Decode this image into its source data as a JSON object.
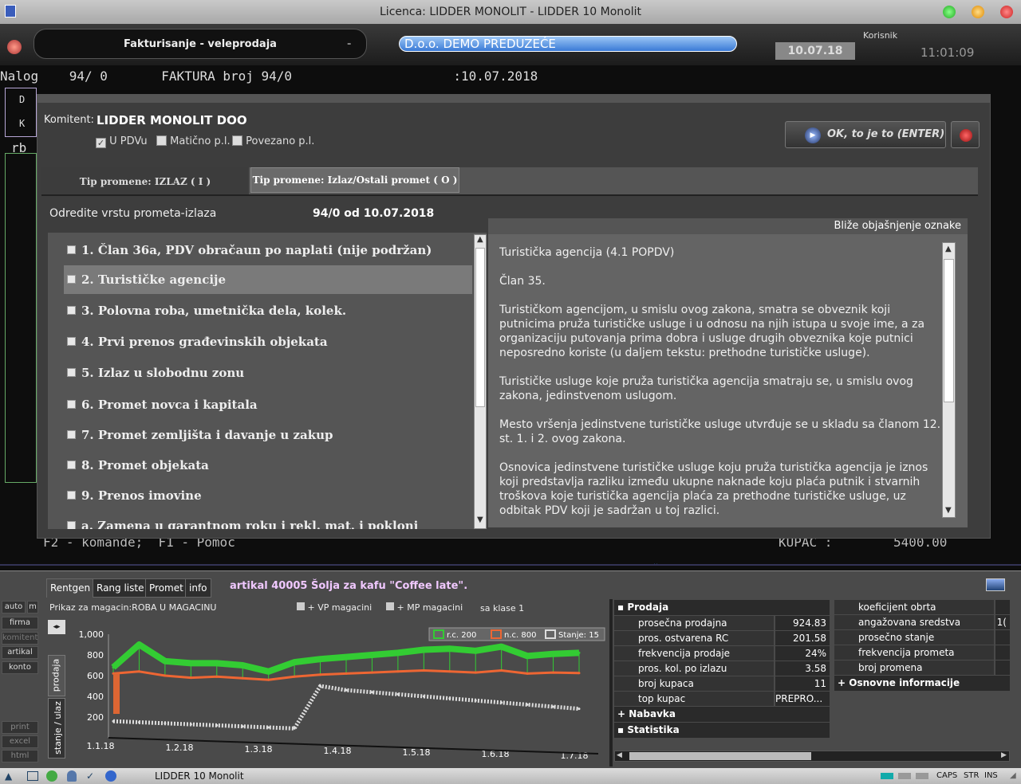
{
  "window": {
    "title": "Licenca: LIDDER MONOLIT - LIDDER 10 Monolit"
  },
  "header": {
    "module": "Fakturisanje - veleprodaja",
    "company": "D.o.o. DEMO PREDUZEĆE",
    "user_label": "Korisnik",
    "date": "10.07.18",
    "time": "11:01:09"
  },
  "terminal": {
    "line1": "Nalog    94/ 0       FAKTURA broj 94/0                     :10.07.2018",
    "rb": "rb",
    "footer": "F2 - komande;  F1 - Pomoc",
    "kupac_label": "KUPAC :",
    "kupac_value": "5400.00",
    "d_letter": "D",
    "k_letter": "K"
  },
  "dialog": {
    "komitent_label": "Komitent:",
    "komitent_value": "LIDDER MONOLIT DOO",
    "checks": [
      {
        "label": "U PDVu",
        "checked": true
      },
      {
        "label": "Matično p.l.",
        "checked": false
      },
      {
        "label": "Povezano p.l.",
        "checked": false
      }
    ],
    "ok_label": "OK, to je to (ENTER)",
    "tabs": [
      {
        "label": "Tip promene: IZLAZ ( I )"
      },
      {
        "label": "Tip promene: Izlaz/Ostali promet ( O )"
      }
    ],
    "prompt": "Odredite vrstu prometa-izlaza",
    "doc_ref": "94/0 od 10.07.2018",
    "items": [
      "1. Član 36a, PDV obračaun po naplati (nije podržan)",
      "2. Turističke agencije",
      "3. Polovna roba, umetnička dela, kolek.",
      "4. Prvi prenos građevinskih objekata",
      "5. Izlaz u slobodnu zonu",
      "6. Promet novca i kapitala",
      "7. Promet zemljišta i davanje u zakup",
      "8. Promet objekata",
      "9. Prenos imovine",
      "a. Zamena u garantnom roku i rekl. mat. i pokloni"
    ],
    "desc_header": "Bliže objašnjenje oznake",
    "desc": [
      "Turistička agencija (4.1 POPDV)",
      "Član 35.",
      "Turističkom agencijom, u smislu ovog zakona, smatra se obveznik koji putnicima pruža turističke usluge i u odnosu na njih istupa u svoje ime, a za organizaciju putovanja prima dobra i usluge drugih obveznika koje putnici neposredno koriste (u daljem tekstu: prethodne turističke usluge).",
      "Turističke usluge koje pruža turistička agencija smatraju se, u smislu ovog zakona, jedinstvenom uslugom.",
      "Mesto vršenja jedinstvene turističke usluge utvrđuje se u skladu sa članom 12. st. 1. i 2. ovog zakona.",
      "Osnovica jedinstvene turističke usluge koju pruža turistička agencija je iznos koji predstavlja razliku između ukupne naknade koju plaća putnik i stvarnih troškova koje turistička agencija plaća za prethodne turističke usluge, uz odbitak PDV koji je sadržan u toj razlici."
    ]
  },
  "bottom": {
    "tabs": [
      "Rentgen",
      "Rang liste",
      "Promet",
      "info"
    ],
    "article": "artikal 40005 Šolja za kafu \"Coffee late\".",
    "side": [
      "auto",
      "m",
      "firma",
      "komitent",
      "artikal",
      "konto",
      "print",
      "excel",
      "html"
    ],
    "prikaz": "Prikaz za magacin:ROBA U MAGACINU",
    "vp": "+ VP magacini",
    "mp": "+ MP magacini",
    "klasa": "sa klase 1",
    "vtabs": [
      "prodaja",
      "stanje / ulaz"
    ],
    "prodaja_title": "Prodaja",
    "prodaja": [
      {
        "k": "prosečna prodajna",
        "v": "924.83"
      },
      {
        "k": "pros. ostvarena RC",
        "v": "201.58"
      },
      {
        "k": "frekvencija prodaje",
        "v": "24%"
      },
      {
        "k": "pros. kol. po izlazu",
        "v": "3.58"
      },
      {
        "k": "broj kupaca",
        "v": "11"
      },
      {
        "k": "top kupac",
        "v": "PREPRO..."
      }
    ],
    "nabavka": "Nabavka",
    "statistika": "Statistika",
    "right": [
      "koeficijent obrta",
      "angažovana sredstva",
      "prosečno stanje",
      "frekvencija prometa",
      "broj promena"
    ],
    "right_v1": "1(",
    "osnovne": "Osnovne informacije"
  },
  "chart_data": {
    "type": "line",
    "x_ticks": [
      "1.1.18",
      "1.2.18",
      "1.3.18",
      "1.4.18",
      "1.5.18",
      "1.6.18",
      "1.7.18"
    ],
    "y_ticks": [
      "1,000",
      "800",
      "600",
      "400",
      "200"
    ],
    "ylim": [
      0,
      1000
    ],
    "series": [
      {
        "name": "r.c. 200",
        "values": [
          680,
          900,
          740,
          720,
          720,
          700,
          640,
          730,
          760,
          780,
          800,
          820,
          850,
          860,
          840,
          880,
          790,
          810,
          820
        ]
      },
      {
        "name": "n.c. 800",
        "values": [
          620,
          640,
          600,
          580,
          590,
          575,
          560,
          590,
          610,
          620,
          630,
          640,
          650,
          640,
          630,
          650,
          620,
          630,
          625
        ]
      },
      {
        "name": "Stanje: 15",
        "values": [
          160,
          150,
          140,
          130,
          120,
          110,
          100,
          90,
          500,
          460,
          440,
          420,
          400,
          380,
          360,
          340,
          320,
          300,
          280
        ]
      }
    ]
  },
  "statusbar": {
    "app": "LIDDER 10 Monolit",
    "caps": "CAPS",
    "str": "STR",
    "ins": "INS"
  }
}
